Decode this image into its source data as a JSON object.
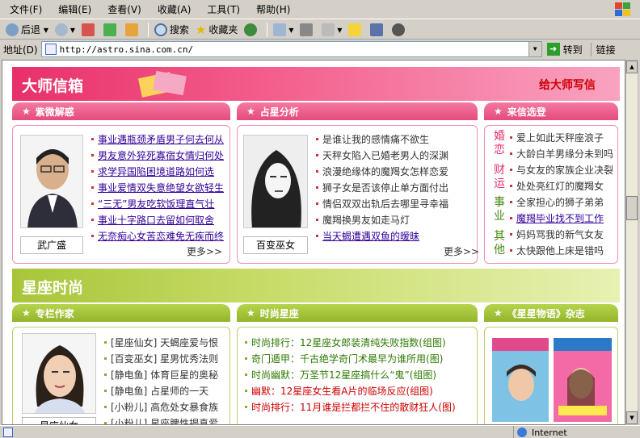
{
  "menu": [
    "文件(F)",
    "编辑(E)",
    "查看(V)",
    "收藏(A)",
    "工具(T)",
    "帮助(H)"
  ],
  "toolbar": {
    "back": "后退",
    "search": "搜索",
    "favorites": "收藏夹"
  },
  "address": {
    "label": "地址(D)",
    "url": "http://astro.sina.com.cn/",
    "go": "转到",
    "links": "链接"
  },
  "status": {
    "zone": "Internet"
  },
  "section1": {
    "title": "大师信箱",
    "write": "给大师写信",
    "tabs": [
      "紫微解惑",
      "占星分析",
      "来信选登"
    ],
    "col1": {
      "caption": "武广盛",
      "items": [
        "事业遇瓶颈矛盾男子何去何从",
        "男友意外猝死寡宿女情归何处",
        "求学异国陷困境道路如何选",
        "事业爱情双失意绝望女欲轻生",
        "“三无”男友吃软饭理直气壮",
        "事业十字路口去留如何取舍",
        "无奈痴心女苦恋难免无疾而终"
      ],
      "more": "更多>>"
    },
    "col2": {
      "caption": "百变巫女",
      "items": [
        "是谁让我的感情痛不欲生",
        "天秤女陷入已婚老男人的深渊",
        "浪漫绝缘体的魔羯女怎样恋爱",
        "狮子女是否该停止单方面付出",
        "情侣双双出轨后去哪里寻幸福",
        "魔羯换男友如走马灯",
        "当天蝎遭遇双鱼的暧昧"
      ],
      "more": "更多>>"
    },
    "col3": {
      "cats": [
        "婚恋",
        "财运",
        "事业",
        "其他"
      ],
      "items": [
        "爱上如此天秤座浪子",
        "大龄白羊男缘分未到吗",
        "与女友的家族企业决裂",
        "处处亮红灯的魔羯女",
        "全家担心的狮子弟弟",
        "魔羯毕业找不到工作",
        "妈妈骂我的新气女友",
        "太快跟他上床是错吗"
      ]
    }
  },
  "section2": {
    "title": "星座时尚",
    "tabs": [
      "专栏作家",
      "时尚星座",
      "《星星物语》杂志"
    ],
    "col1": {
      "caption": "星座仙女",
      "items": [
        "[星座仙女] 天蝎座爱与恨",
        "[百变巫女] 星男忧秀法则",
        "[静电鱼] 体育巨星的奥秘",
        "[静电鱼] 占星师的一天",
        "[小粉儿] 高危处女暴食族",
        "[小粉儿] 星座脾性揭真爱"
      ]
    },
    "col2": {
      "items": [
        {
          "prefix": "时尚排行：",
          "text": "12星座女郎装清纯失败指数(组图)"
        },
        {
          "prefix": "奇门遁甲：",
          "text": "千古绝学奇门术最早为谁所用(图)"
        },
        {
          "prefix": "时尚幽默：",
          "text": "万圣节12星座搞什么“鬼”(组图)"
        },
        {
          "prefix": "幽默：",
          "text": "12星座女生看A片的临场反应(组图)"
        },
        {
          "prefix": "时尚排行：",
          "text": "11月谁是拦都拦不住的散财狂人(图)"
        }
      ]
    }
  }
}
